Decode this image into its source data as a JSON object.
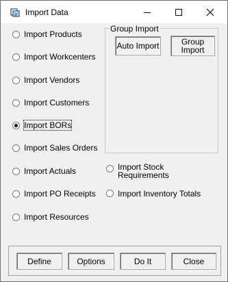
{
  "window": {
    "title": "Import Data"
  },
  "left_options": [
    {
      "label": "Import Products",
      "checked": false
    },
    {
      "label": "Import Workcenters",
      "checked": false
    },
    {
      "label": "Import Vendors",
      "checked": false
    },
    {
      "label": "Import Customers",
      "checked": false
    },
    {
      "label": "Import BORs",
      "checked": true
    },
    {
      "label": "Import Sales Orders",
      "checked": false
    },
    {
      "label": "Import Actuals",
      "checked": false
    },
    {
      "label": "Import PO Receipts",
      "checked": false
    },
    {
      "label": "Import Resources",
      "checked": false
    }
  ],
  "group_import": {
    "title": "Group Import",
    "auto_import_label": "Auto Import",
    "group_import_label_1": "Group",
    "group_import_label_2": "Import"
  },
  "right_options": {
    "stock_requirements_line1": "Import Stock",
    "stock_requirements_line2": "Requirements",
    "inventory_totals": "Import Inventory Totals"
  },
  "buttons": {
    "define": "Define",
    "options": "Options",
    "do_it": "Do It",
    "close": "Close"
  }
}
